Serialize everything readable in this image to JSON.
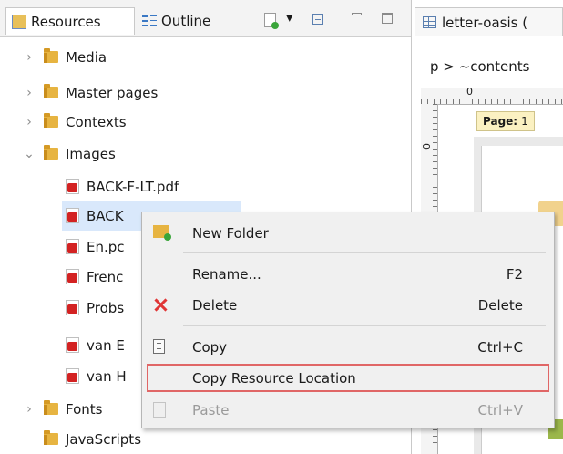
{
  "tabs": [
    {
      "label": "Resources",
      "active": true,
      "icon": "resources-icon"
    },
    {
      "label": "Outline",
      "active": false,
      "icon": "outline-icon"
    }
  ],
  "toolbar": {
    "icons": [
      "new-resource-icon",
      "dropdown-arrow-icon",
      "collapse-all-icon",
      "minimize-icon",
      "maximize-icon"
    ],
    "dropdown_glyph": "▾"
  },
  "tree": {
    "folders_top": [
      {
        "label": "Media",
        "expanded": false
      },
      {
        "label": "Master pages",
        "expanded": false
      },
      {
        "label": "Contexts",
        "expanded": false
      },
      {
        "label": "Images",
        "expanded": true
      }
    ],
    "image_files": [
      {
        "label": "BACK-F-LT.pdf"
      },
      {
        "label": "BACK-M-LT.pdf",
        "selected": true,
        "visible_text": "BACK"
      },
      {
        "label": "En.pdf",
        "visible_text": "En.pc"
      },
      {
        "label": "French",
        "visible_text": "Frenc"
      },
      {
        "label": "Probs",
        "visible_text": "Probs"
      },
      {
        "label": "van E",
        "visible_text": "van E"
      },
      {
        "label": "van H",
        "visible_text": "van H"
      }
    ],
    "folders_bottom": [
      {
        "label": "Fonts",
        "expanded": false
      },
      {
        "label": "JavaScripts",
        "expanded": false
      }
    ],
    "chevron_collapsed": "›",
    "chevron_expanded": "⌄"
  },
  "editor": {
    "tab_title": "letter-oasis (",
    "breadcrumb": "p > ~contents",
    "ruler_zero": "0",
    "page_label": "Page:",
    "page_number": "1"
  },
  "context_menu": {
    "items": [
      {
        "label": "New Folder",
        "shortcut": "",
        "icon": "new-folder-icon",
        "enabled": true
      },
      {
        "label": "Rename...",
        "shortcut": "F2",
        "icon": "",
        "enabled": true
      },
      {
        "label": "Delete",
        "shortcut": "Delete",
        "icon": "delete-x-icon",
        "enabled": true
      },
      {
        "label": "Copy",
        "shortcut": "Ctrl+C",
        "icon": "copy-icon",
        "enabled": true
      },
      {
        "label": "Copy Resource Location",
        "shortcut": "",
        "icon": "",
        "enabled": true,
        "highlighted": true
      },
      {
        "label": "Paste",
        "shortcut": "Ctrl+V",
        "icon": "paste-icon",
        "enabled": false
      }
    ]
  },
  "colors": {
    "highlight_outline": "#e06666",
    "selection": "#d9e8fb",
    "delete_icon": "#e03535",
    "folder": "#e7b441"
  }
}
